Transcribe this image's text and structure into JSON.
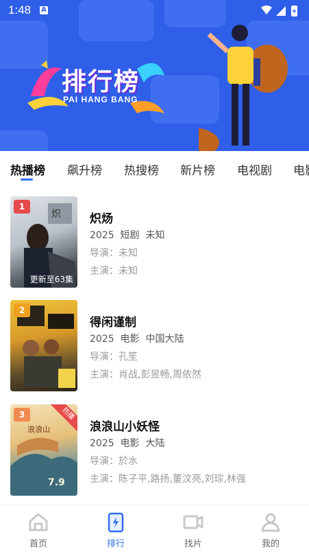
{
  "status_bar": {
    "time": "1:48"
  },
  "banner": {
    "title": "排行榜",
    "subtitle": "PAI HANG BANG"
  },
  "tabs": [
    "热播榜",
    "飙升榜",
    "热搜榜",
    "新片榜",
    "电视剧",
    "电影"
  ],
  "active_tab": 0,
  "items": [
    {
      "rank": "1",
      "title": "炽炀",
      "year": "2025",
      "type": "短剧",
      "region": "未知",
      "director_label": "导演：",
      "director": "未知",
      "cast_label": "主演：",
      "cast": "未知",
      "poster_caption": "更新至63集",
      "poster_tag": "",
      "rank_color": "#e74a4a"
    },
    {
      "rank": "2",
      "title": "得闲谨制",
      "year": "2025",
      "type": "电影",
      "region": "中国大陆",
      "director_label": "导演：",
      "director": "孔笙",
      "cast_label": "主演：",
      "cast": "肖战,彭昱畅,周依然",
      "poster_caption": "",
      "poster_tag": "",
      "rank_color": "#f0a020"
    },
    {
      "rank": "3",
      "title": "浪浪山小妖怪",
      "year": "2025",
      "type": "电影",
      "region": "大陆",
      "director_label": "导演：",
      "director": "於水",
      "cast_label": "主演：",
      "cast": "陈子平,路扬,董汶亮,刘琮,林强",
      "poster_caption": "",
      "poster_tag": "热播",
      "rank_color": "#f08a50"
    }
  ],
  "bottom_nav": [
    {
      "label": "首页",
      "icon": "home-icon"
    },
    {
      "label": "排行",
      "icon": "ranking-icon"
    },
    {
      "label": "找片",
      "icon": "video-camera-icon"
    },
    {
      "label": "我的",
      "icon": "profile-icon"
    }
  ],
  "active_nav": 1,
  "colors": {
    "accent": "#2f6ef0",
    "banner_bg": "#2f5fe8"
  }
}
